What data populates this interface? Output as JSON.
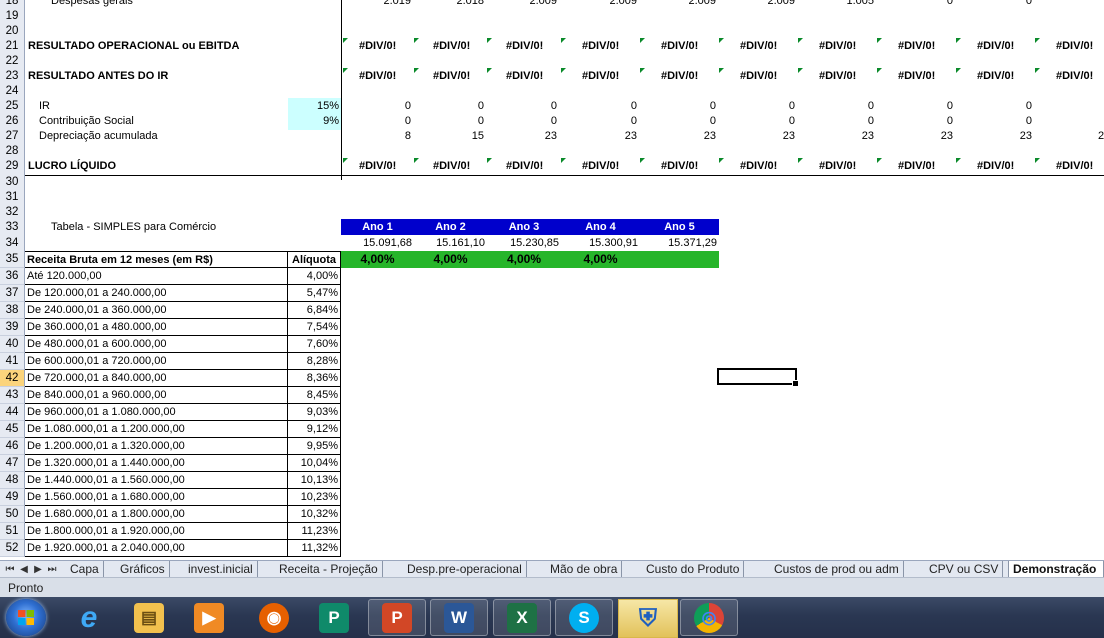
{
  "year_header": [
    "Ano 1",
    "Ano 2",
    "Ano 3",
    "Ano 4",
    "Ano 5"
  ],
  "year_revenue": [
    "15.091,68",
    "15.161,10",
    "15.230,85",
    "15.300,91",
    "15.371,29"
  ],
  "year_rate": [
    "4,00%",
    "4,00%",
    "4,00%",
    "4,00%"
  ],
  "rows": {
    "r18": {
      "num": "18",
      "label": "Despesas gerais",
      "values": [
        "2.019",
        "2.018",
        "2.009",
        "2.009",
        "2.009",
        "2.009",
        "1.005",
        "0",
        "0"
      ]
    },
    "r19": {
      "num": "19"
    },
    "r20": {
      "num": "20"
    },
    "r21": {
      "num": "21",
      "label": "RESULTADO OPERACIONAL ou EBITDA",
      "values": [
        "#DIV/0!",
        "#DIV/0!",
        "#DIV/0!",
        "#DIV/0!",
        "#DIV/0!",
        "#DIV/0!",
        "#DIV/0!",
        "#DIV/0!",
        "#DIV/0!",
        "#DIV/0!"
      ]
    },
    "r22": {
      "num": "22"
    },
    "r23": {
      "num": "23",
      "label": "RESULTADO ANTES DO IR",
      "values": [
        "#DIV/0!",
        "#DIV/0!",
        "#DIV/0!",
        "#DIV/0!",
        "#DIV/0!",
        "#DIV/0!",
        "#DIV/0!",
        "#DIV/0!",
        "#DIV/0!",
        "#DIV/0!"
      ]
    },
    "r24": {
      "num": "24"
    },
    "r25": {
      "num": "25",
      "label": "IR",
      "rate": "15%",
      "values": [
        "0",
        "0",
        "0",
        "0",
        "0",
        "0",
        "0",
        "0",
        "0"
      ]
    },
    "r26": {
      "num": "26",
      "label": "Contribuição Social",
      "rate": "9%",
      "values": [
        "0",
        "0",
        "0",
        "0",
        "0",
        "0",
        "0",
        "0",
        "0"
      ]
    },
    "r27": {
      "num": "27",
      "label": "Depreciação acumulada",
      "values": [
        "8",
        "15",
        "23",
        "23",
        "23",
        "23",
        "23",
        "23",
        "23",
        "2"
      ]
    },
    "r28": {
      "num": "28"
    },
    "r29": {
      "num": "29",
      "label": "LUCRO LÍQUIDO",
      "values": [
        "#DIV/0!",
        "#DIV/0!",
        "#DIV/0!",
        "#DIV/0!",
        "#DIV/0!",
        "#DIV/0!",
        "#DIV/0!",
        "#DIV/0!",
        "#DIV/0!",
        "#DIV/0!"
      ]
    },
    "r30": {
      "num": "30"
    },
    "r31": {
      "num": "31"
    },
    "r32": {
      "num": "32"
    },
    "r33": {
      "num": "33",
      "label": "Tabela - SIMPLES para Comércio"
    },
    "r34": {
      "num": "34"
    },
    "r35": {
      "num": "35",
      "label": "Receita Bruta em 12 meses (em R$)",
      "rate_header": "Alíquota"
    }
  },
  "simples": [
    {
      "num": "36",
      "range": "Até 120.000,00",
      "rate": "4,00%"
    },
    {
      "num": "37",
      "range": "De 120.000,01 a 240.000,00",
      "rate": "5,47%"
    },
    {
      "num": "38",
      "range": "De 240.000,01 a 360.000,00",
      "rate": "6,84%"
    },
    {
      "num": "39",
      "range": "De 360.000,01 a 480.000,00",
      "rate": "7,54%"
    },
    {
      "num": "40",
      "range": "De 480.000,01 a 600.000,00",
      "rate": "7,60%"
    },
    {
      "num": "41",
      "range": "De 600.000,01 a 720.000,00",
      "rate": "8,28%"
    },
    {
      "num": "42",
      "range": "De 720.000,01 a 840.000,00",
      "rate": "8,36%"
    },
    {
      "num": "43",
      "range": "De 840.000,01 a 960.000,00",
      "rate": "8,45%"
    },
    {
      "num": "44",
      "range": "De 960.000,01 a 1.080.000,00",
      "rate": "9,03%"
    },
    {
      "num": "45",
      "range": "De 1.080.000,01 a 1.200.000,00",
      "rate": "9,12%"
    },
    {
      "num": "46",
      "range": "De 1.200.000,01 a 1.320.000,00",
      "rate": "9,95%"
    },
    {
      "num": "47",
      "range": "De 1.320.000,01 a 1.440.000,00",
      "rate": "10,04%"
    },
    {
      "num": "48",
      "range": "De 1.440.000,01 a 1.560.000,00",
      "rate": "10,13%"
    },
    {
      "num": "49",
      "range": "De 1.560.000,01 a 1.680.000,00",
      "rate": "10,23%"
    },
    {
      "num": "50",
      "range": "De 1.680.000,01 a 1.800.000,00",
      "rate": "10,32%"
    },
    {
      "num": "51",
      "range": "De 1.800.000,01 a 1.920.000,00",
      "rate": "11,23%"
    },
    {
      "num": "52",
      "range": "De 1.920.000,01 a 2.040.000,00",
      "rate": "11,32%"
    }
  ],
  "tabs": [
    "Capa",
    "Gráficos",
    "invest.inicial",
    "Receita - Projeção",
    "Desp.pre-operacional",
    "Mão de obra",
    "Custo do Produto",
    "Custos de prod ou adm",
    "CPV ou CSV",
    "Demonstração"
  ],
  "nav": [
    "⏮",
    "◀",
    "▶",
    "⏭"
  ],
  "status_text": "Pronto",
  "taskbar_labels": {
    "ie": "e",
    "explorer": "▤",
    "media": "▶",
    "firefox": "◉",
    "publisher": "P",
    "powerpoint": "P",
    "word": "W",
    "excel": "X",
    "skype": "S",
    "security": "⛨",
    "chrome": "◎"
  }
}
